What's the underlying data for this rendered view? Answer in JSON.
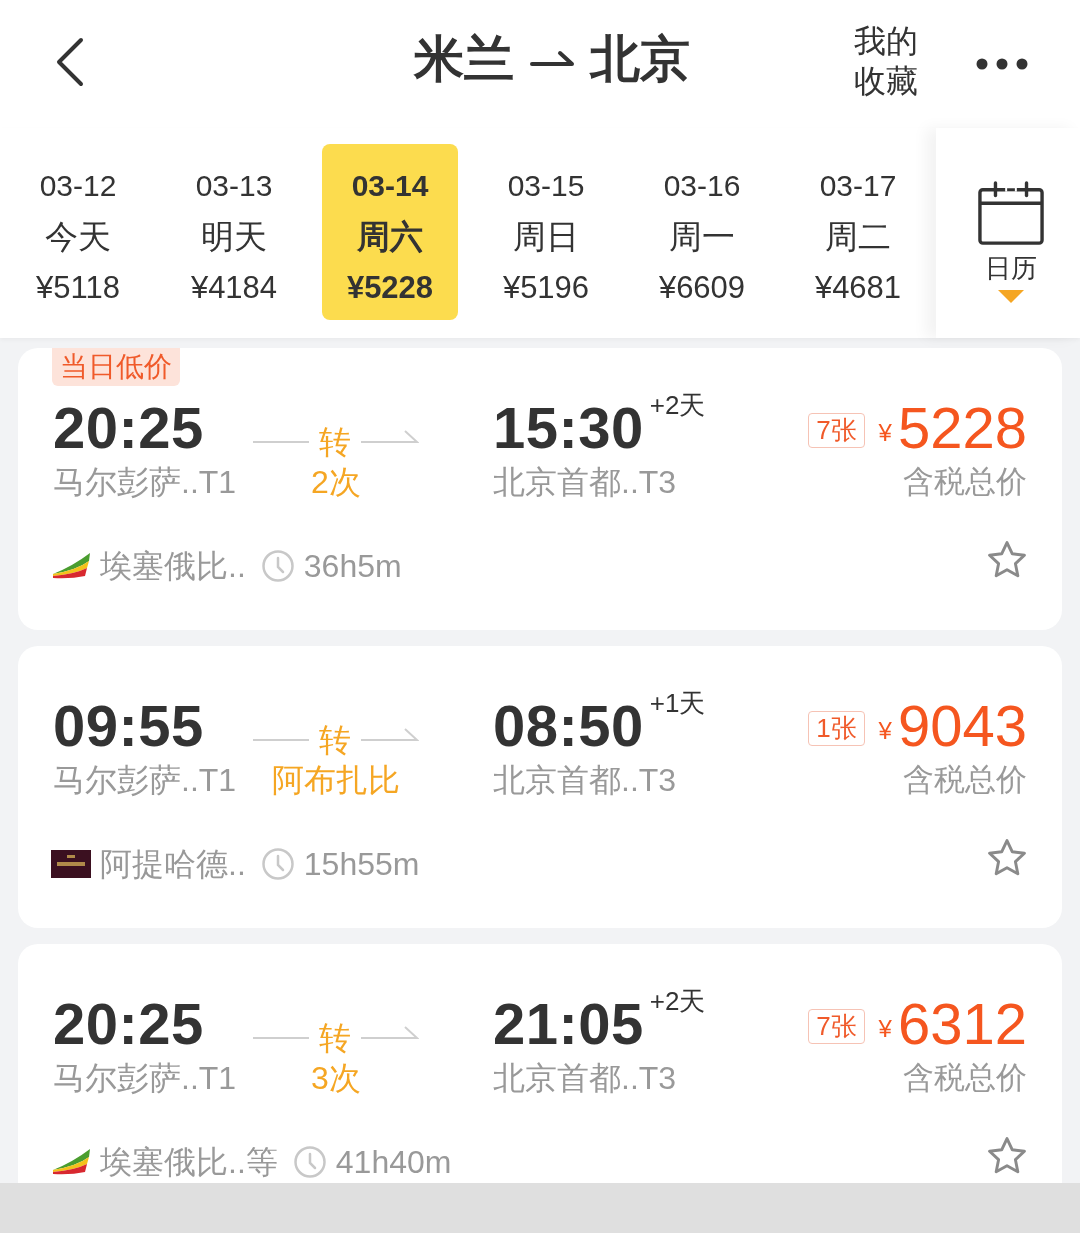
{
  "header": {
    "origin": "米兰",
    "destination": "北京",
    "favorites": "我的收藏"
  },
  "dates": [
    {
      "date": "03-12",
      "day": "今天",
      "price": "¥5118",
      "selected": false
    },
    {
      "date": "03-13",
      "day": "明天",
      "price": "¥4184",
      "selected": false
    },
    {
      "date": "03-14",
      "day": "周六",
      "price": "¥5228",
      "selected": true
    },
    {
      "date": "03-15",
      "day": "周日",
      "price": "¥5196",
      "selected": false
    },
    {
      "date": "03-16",
      "day": "周一",
      "price": "¥6609",
      "selected": false
    },
    {
      "date": "03-17",
      "day": "周二",
      "price": "¥4681",
      "selected": false
    }
  ],
  "calendar": {
    "label": "日历"
  },
  "flights": [
    {
      "badge": "当日低价",
      "departure": {
        "time": "20:25",
        "airport": "马尔彭萨..T1"
      },
      "transfer": {
        "mark": "转",
        "detail": "2次"
      },
      "arrival": {
        "time": "15:30",
        "day_offset": "+2天",
        "airport": "北京首都..T3"
      },
      "tickets": "7张",
      "currency": "¥",
      "price": "5228",
      "price_note": "含税总价",
      "airline": {
        "kind": "tail",
        "name": "埃塞俄比.."
      },
      "duration": "36h5m",
      "favorited": false
    },
    {
      "departure": {
        "time": "09:55",
        "airport": "马尔彭萨..T1"
      },
      "transfer": {
        "mark": "转",
        "detail": "阿布扎比"
      },
      "arrival": {
        "time": "08:50",
        "day_offset": "+1天",
        "airport": "北京首都..T3"
      },
      "tickets": "1张",
      "currency": "¥",
      "price": "9043",
      "price_note": "含税总价",
      "airline": {
        "kind": "plate",
        "name": "阿提哈德.."
      },
      "duration": "15h55m",
      "favorited": false
    },
    {
      "departure": {
        "time": "20:25",
        "airport": "马尔彭萨..T1"
      },
      "transfer": {
        "mark": "转",
        "detail": "3次"
      },
      "arrival": {
        "time": "21:05",
        "day_offset": "+2天",
        "airport": "北京首都..T3"
      },
      "tickets": "7张",
      "currency": "¥",
      "price": "6312",
      "price_note": "含税总价",
      "airline": {
        "kind": "tail",
        "name": "埃塞俄比..等"
      },
      "duration": "41h40m",
      "favorited": false
    }
  ]
}
